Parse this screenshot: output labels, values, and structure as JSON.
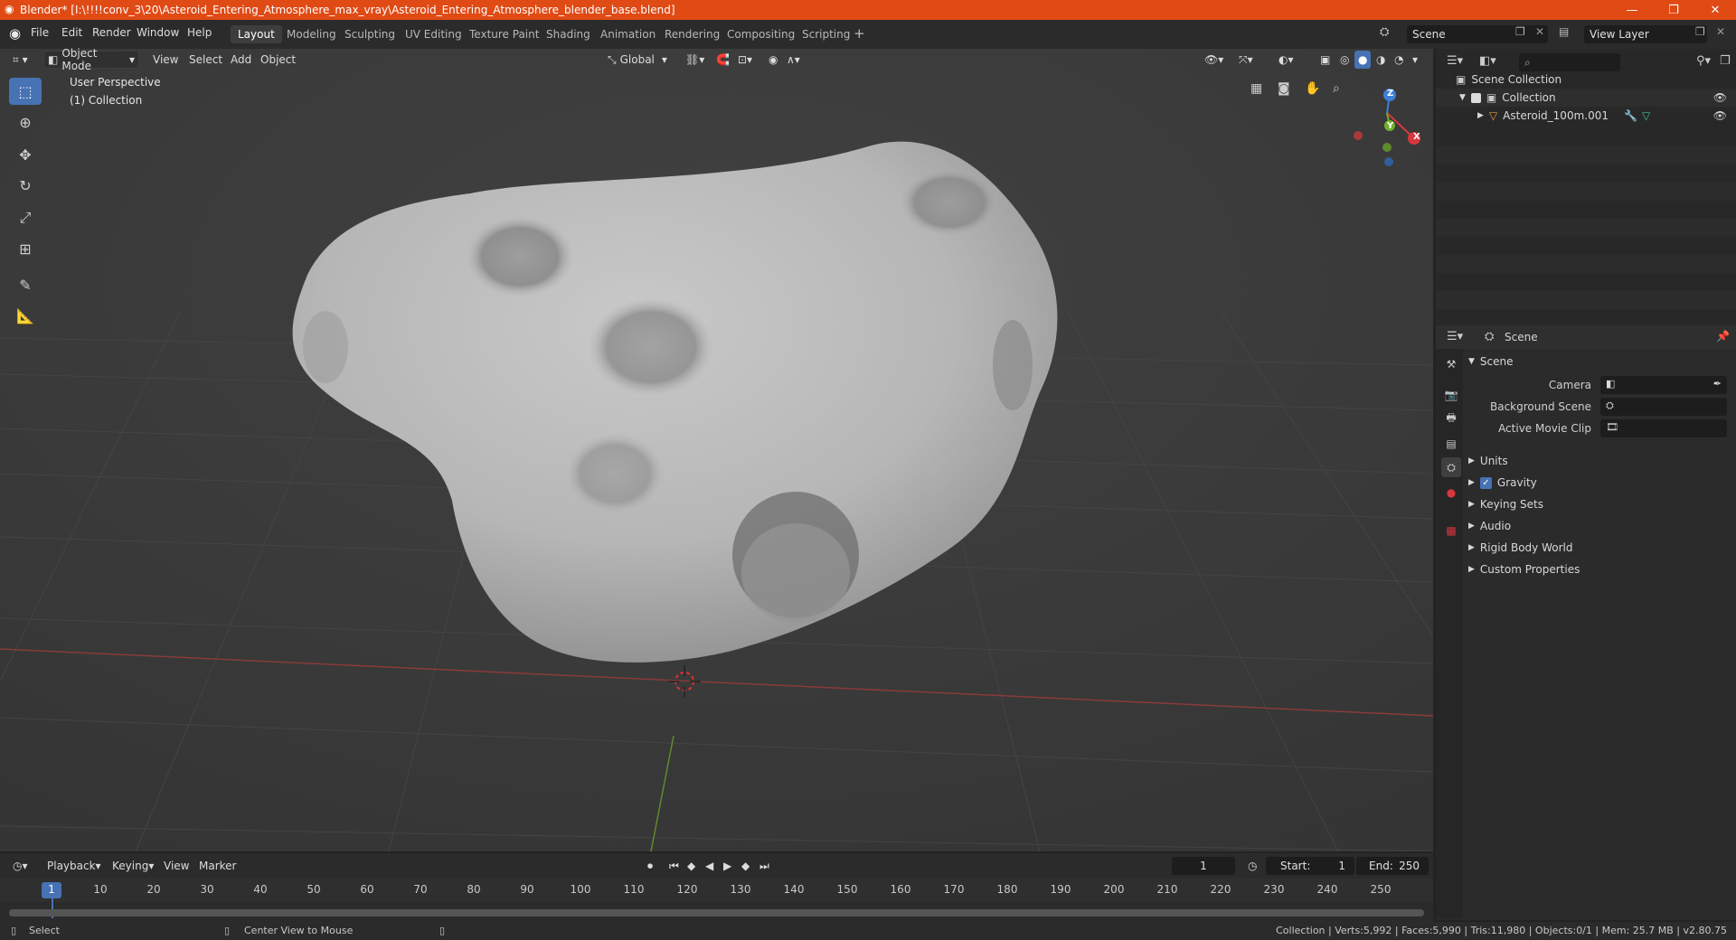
{
  "window": {
    "title": "Blender* [I:\\!!!!conv_3\\20\\Asteroid_Entering_Atmosphere_max_vray\\Asteroid_Entering_Atmosphere_blender_base.blend]",
    "controls": [
      "minimize",
      "maximize",
      "close"
    ]
  },
  "menu": [
    "File",
    "Edit",
    "Render",
    "Window",
    "Help"
  ],
  "workspaces": [
    {
      "label": "Layout",
      "active": true
    },
    {
      "label": "Modeling"
    },
    {
      "label": "Sculpting"
    },
    {
      "label": "UV Editing"
    },
    {
      "label": "Texture Paint"
    },
    {
      "label": "Shading"
    },
    {
      "label": "Animation"
    },
    {
      "label": "Rendering"
    },
    {
      "label": "Compositing"
    },
    {
      "label": "Scripting"
    }
  ],
  "scene_selector": {
    "value": "Scene"
  },
  "view_layer_selector": {
    "value": "View Layer"
  },
  "viewport_header": {
    "mode": "Object Mode",
    "menus": [
      "View",
      "Select",
      "Add",
      "Object"
    ],
    "transform_orientation": "Global"
  },
  "viewport": {
    "perspective_label": "User Perspective",
    "collection_label": "(1) Collection",
    "gizmo_axes": {
      "x": "X",
      "y": "Y",
      "z": "Z"
    }
  },
  "tools": [
    "select-box",
    "cursor",
    "move",
    "rotate",
    "scale",
    "transform",
    "annotate",
    "measure"
  ],
  "outliner": {
    "root": "Scene Collection",
    "collection": "Collection",
    "object": "Asteroid_100m.001"
  },
  "properties": {
    "context": "Scene",
    "panel_title": "Scene",
    "fields": [
      {
        "label": "Camera",
        "value": ""
      },
      {
        "label": "Background Scene",
        "value": ""
      },
      {
        "label": "Active Movie Clip",
        "value": ""
      }
    ],
    "subpanels": [
      "Units",
      "Gravity",
      "Keying Sets",
      "Audio",
      "Rigid Body World",
      "Custom Properties"
    ],
    "gravity_checked": true
  },
  "timeline": {
    "menus": [
      "Playback",
      "Keying",
      "View",
      "Marker"
    ],
    "current_frame": "1",
    "start_label": "Start:",
    "start": "1",
    "end_label": "End:",
    "end": "250",
    "ruler": [
      "1",
      "10",
      "20",
      "30",
      "40",
      "50",
      "60",
      "70",
      "80",
      "90",
      "100",
      "110",
      "120",
      "130",
      "140",
      "150",
      "160",
      "170",
      "180",
      "190",
      "200",
      "210",
      "220",
      "230",
      "240",
      "250"
    ]
  },
  "statusbar": {
    "left_action": "Select",
    "middle_action": "Center View to Mouse",
    "info": "Collection | Verts:5,992 | Faces:5,990 | Tris:11,980 | Objects:0/1 | Mem: 25.7 MB | v2.80.75"
  },
  "colors": {
    "title_bar": "#e04a15",
    "accent": "#4772b3",
    "x_axis": "#d9363e",
    "y_axis": "#6fb02e",
    "z_axis": "#3d7fd6"
  }
}
